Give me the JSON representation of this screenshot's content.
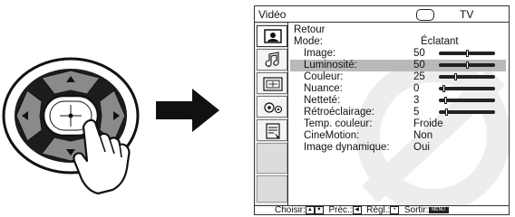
{
  "osd": {
    "title": "Vidéo",
    "tv_label": "TV",
    "side_icons": [
      "picture-settings-icon",
      "sound-icon",
      "screen-icon",
      "setup-icon",
      "features-icon"
    ],
    "items": [
      {
        "label": "Retour",
        "value": ""
      },
      {
        "label": "Mode:",
        "value": "Éclatant"
      },
      {
        "label": "Image:",
        "value": "50",
        "level": 50,
        "slider": true,
        "selected": true
      },
      {
        "label": "Luminosité:",
        "value": "50",
        "level": 50,
        "slider": true
      },
      {
        "label": "Couleur:",
        "value": "25",
        "level": 25,
        "slider": true
      },
      {
        "label": "Nuance:",
        "value": "0",
        "level": 0,
        "slider": true
      },
      {
        "label": "Netteté:",
        "value": "3",
        "level": 3,
        "slider": true
      },
      {
        "label": "Rétroéclairage:",
        "value": "5",
        "level": 5,
        "slider": true
      },
      {
        "label": "Temp. couleur:",
        "value": "Froide"
      },
      {
        "label": "CineMotion:",
        "value": "Non"
      },
      {
        "label": "Image dynamique:",
        "value": "Oui"
      }
    ],
    "footer": {
      "select": "Choisir:",
      "prev": "Préc.:",
      "adjust": "Régl.:",
      "exit": "Sortir:",
      "menu_key": "MENU"
    }
  }
}
